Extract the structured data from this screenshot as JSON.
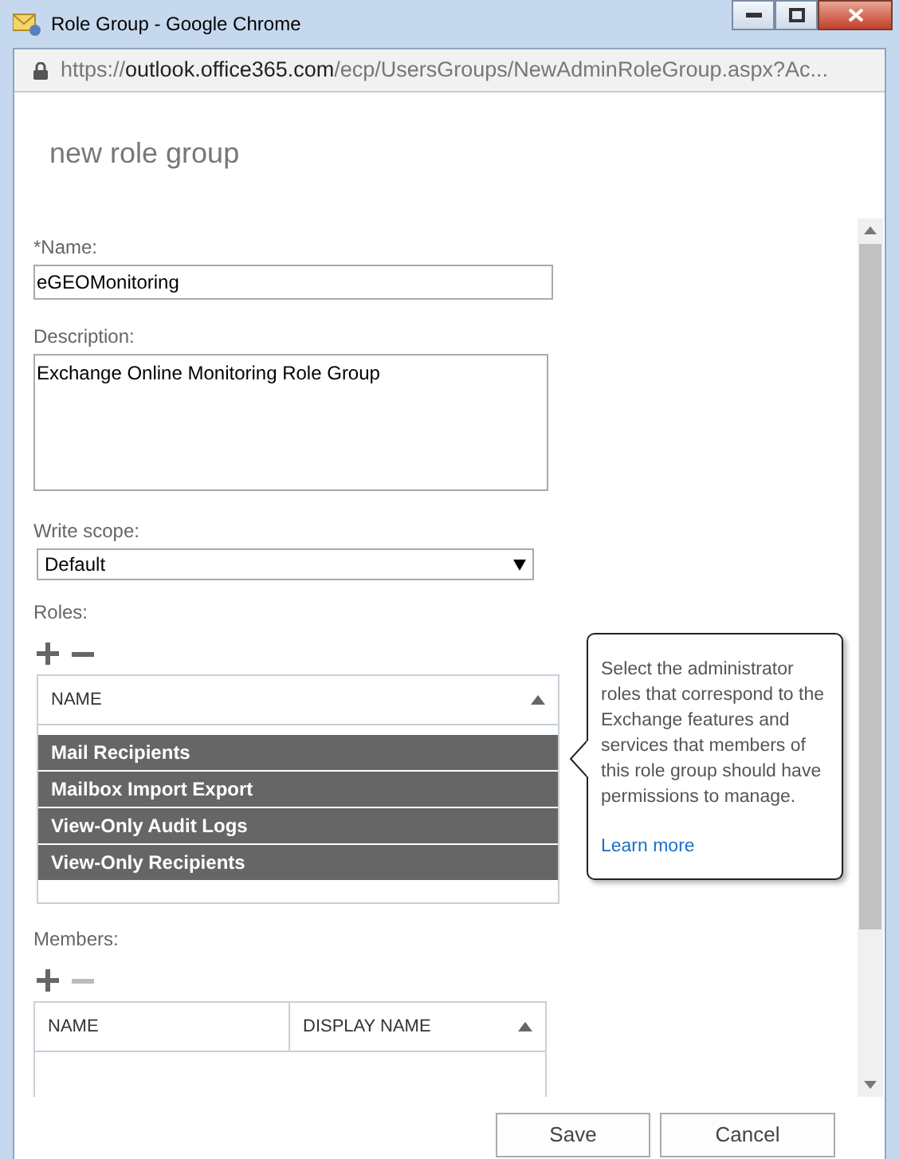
{
  "window": {
    "title": "Role Group - Google Chrome"
  },
  "address_bar": {
    "scheme": "https://",
    "host": "outlook.office365.com",
    "path": "/ecp/UsersGroups/NewAdminRoleGroup.aspx?Ac..."
  },
  "heading": "new role group",
  "form": {
    "name": {
      "label": "*Name:",
      "value": "eGEOMonitoring"
    },
    "description": {
      "label": "Description:",
      "value": "Exchange Online Monitoring Role Group"
    },
    "write_scope": {
      "label": "Write scope:",
      "value": "Default"
    },
    "roles": {
      "label": "Roles:",
      "remove_disabled": false,
      "columns": [
        "NAME"
      ],
      "rows": [
        {
          "name": "Mail Recipients",
          "selected": true
        },
        {
          "name": "Mailbox Import Export",
          "selected": true
        },
        {
          "name": "View-Only Audit Logs",
          "selected": true
        },
        {
          "name": "View-Only Recipients",
          "selected": true
        }
      ]
    },
    "members": {
      "label": "Members:",
      "remove_disabled": true,
      "columns": [
        "NAME",
        "DISPLAY NAME"
      ]
    }
  },
  "tooltip": {
    "text": "Select the administrator roles that correspond to the Exchange features and services that members of this role group should have permissions to manage.",
    "link": "Learn more"
  },
  "buttons": [
    "Save",
    "Cancel"
  ]
}
